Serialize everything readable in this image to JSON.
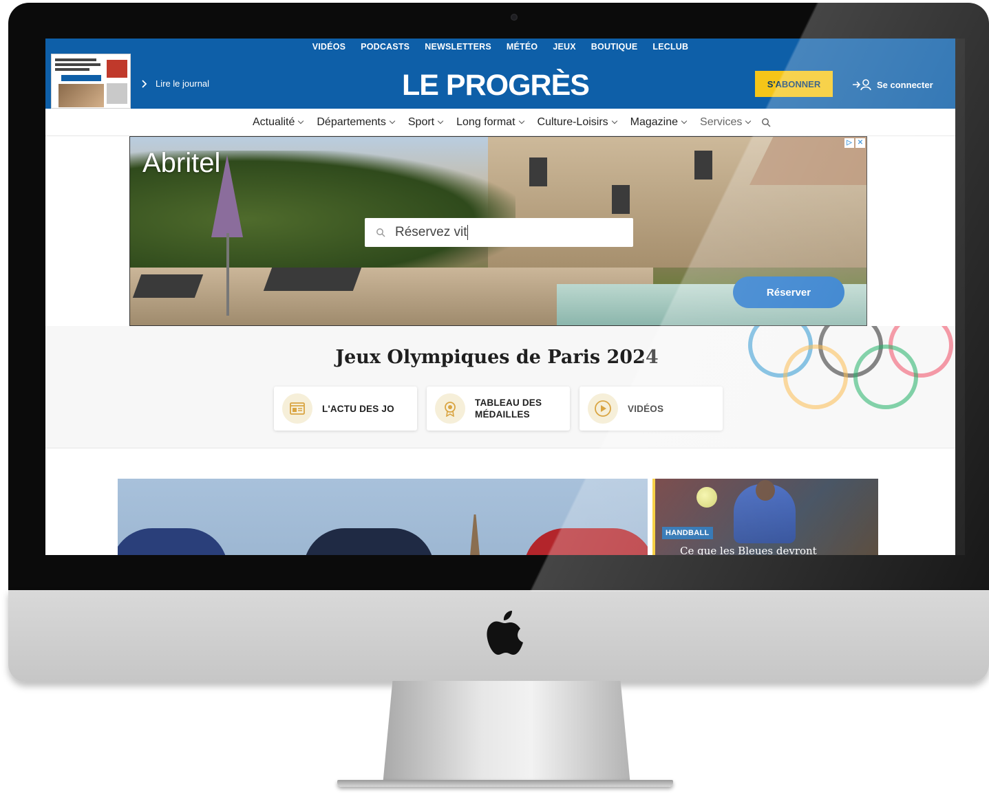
{
  "top_nav": [
    "VIDÉOS",
    "PODCASTS",
    "NEWSLETTERS",
    "MÉTÉO",
    "JEUX",
    "BOUTIQUE",
    "LECLUB"
  ],
  "header": {
    "journal_link": "Lire le journal",
    "brand": "LE PROGRÈS",
    "subscribe": "S'ABONNER",
    "login": "Se connecter"
  },
  "main_nav": [
    "Actualité",
    "Départements",
    "Sport",
    "Long format",
    "Culture-Loisirs",
    "Magazine",
    "Services"
  ],
  "ad": {
    "brand": "Abritel",
    "search_value": "Réservez vit",
    "button": "Réserver"
  },
  "olympics": {
    "title": "Jeux Olympiques de Paris 2024",
    "cards": [
      {
        "label": "L'ACTU DES JO",
        "icon": "newspaper-icon"
      },
      {
        "label": "TABLEAU DES MÉDAILLES",
        "icon": "medal-icon"
      },
      {
        "label": "VIDÉOS",
        "icon": "play-icon"
      }
    ],
    "ring_colors": [
      "#0081c8",
      "#000000",
      "#ee334e",
      "#fcb131",
      "#00a651"
    ]
  },
  "articles": {
    "side_tag": "HANDBALL",
    "side_headline": "Ce que les Bleues devront"
  },
  "colors": {
    "brand_blue": "#0e5fa8",
    "subscribe_yellow": "#f5c518",
    "ad_button_blue": "#1f73c9"
  }
}
